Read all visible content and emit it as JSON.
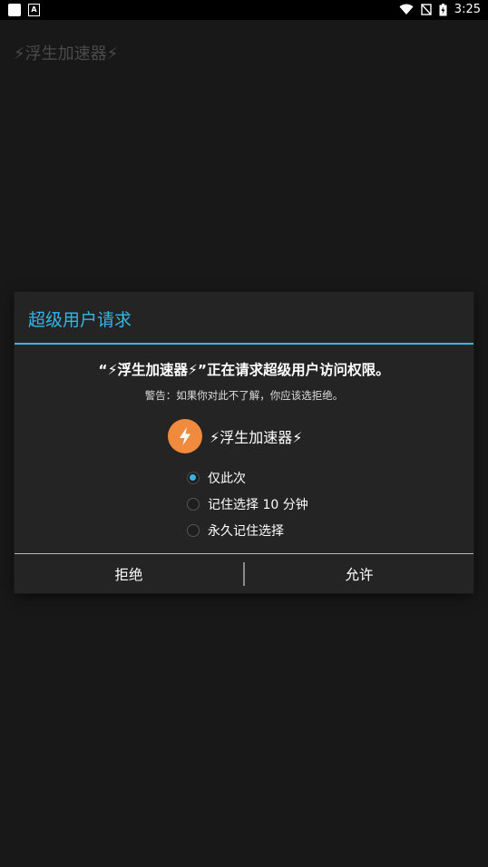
{
  "status_bar": {
    "time": "3:25",
    "notif_a": "A"
  },
  "app": {
    "title": "⚡浮生加速器⚡"
  },
  "dialog": {
    "title": "超级用户请求",
    "message": "“⚡浮生加速器⚡”正在请求超级用户访问权限。",
    "warning": "警告：如果你对此不了解，你应该选拒绝。",
    "app_name": "⚡浮生加速器⚡",
    "options": [
      {
        "label": "仅此次",
        "selected": true
      },
      {
        "label": "记住选择 10 分钟",
        "selected": false
      },
      {
        "label": "永久记住选择",
        "selected": false
      }
    ],
    "deny_label": "拒绝",
    "allow_label": "允许"
  },
  "colors": {
    "accent": "#33b5e5",
    "icon_bg": "#f08a3c",
    "background": "#181818",
    "dialog_bg": "#242424"
  }
}
